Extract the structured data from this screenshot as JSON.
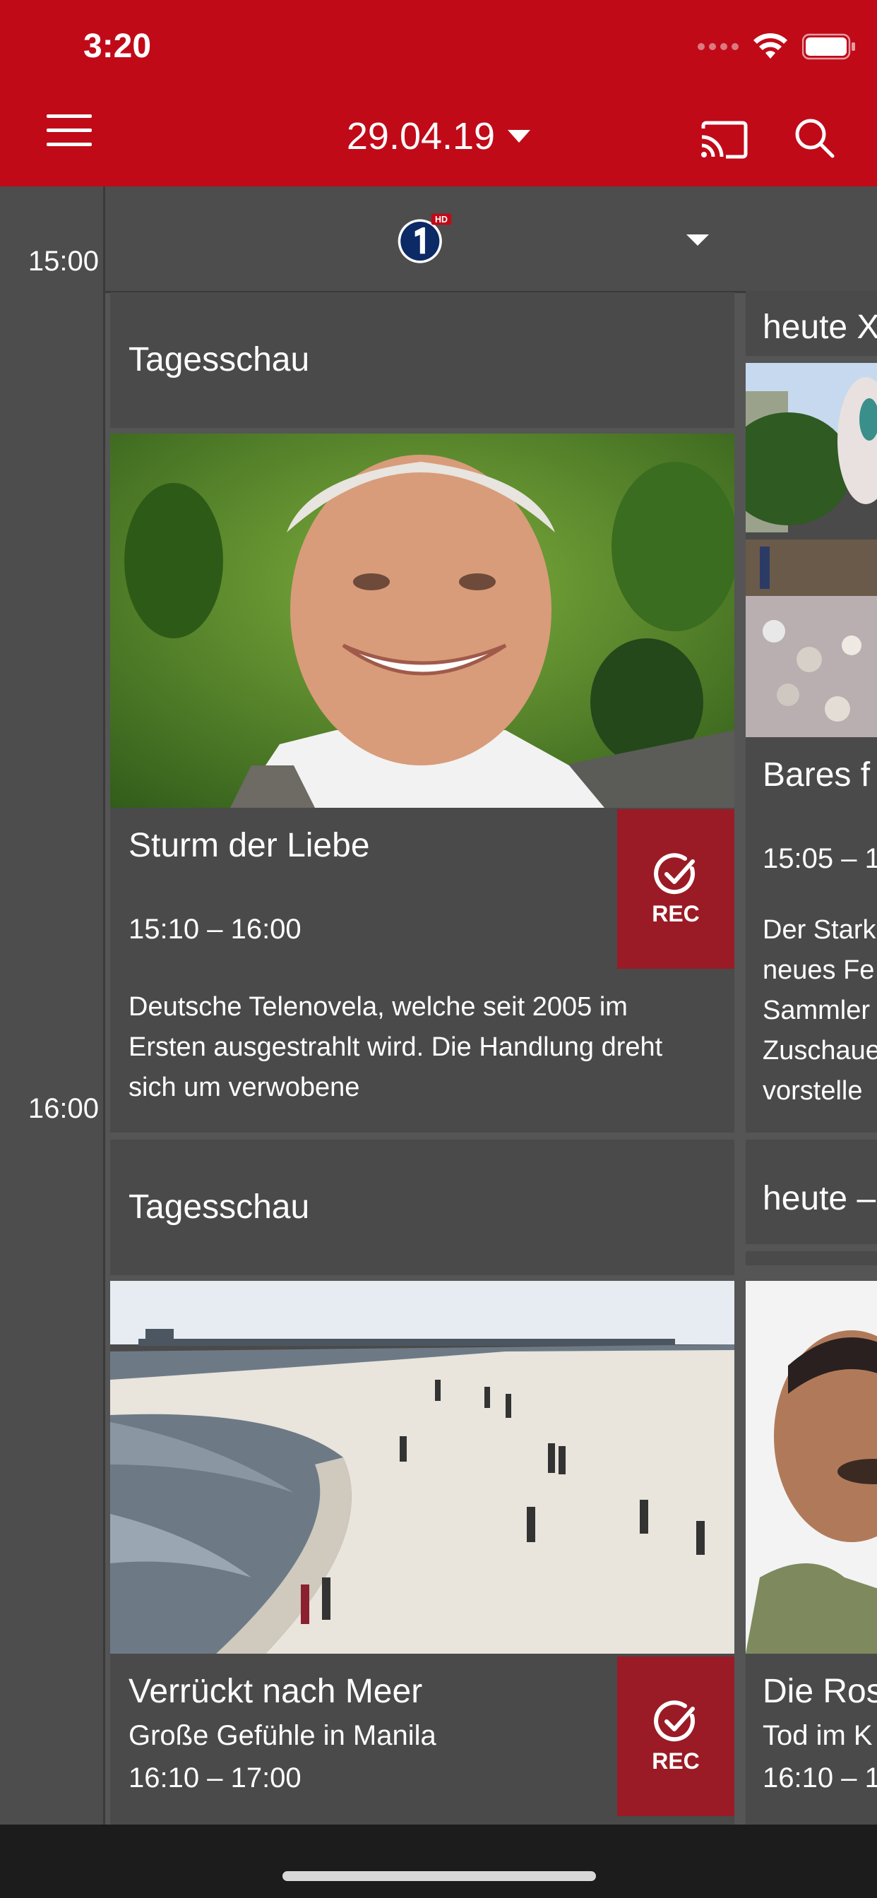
{
  "status_bar": {
    "time": "3:20"
  },
  "header": {
    "date": "29.04.19"
  },
  "channel": {
    "logo_text": "1",
    "badge": "HD"
  },
  "time_labels": {
    "t1": "15:00",
    "t2": "16:00"
  },
  "column1": {
    "news1_title": "Tagesschau",
    "prog1": {
      "title": "Sturm der Liebe",
      "time": "15:10 – 16:00",
      "desc": "Deutsche Telenovela, welche seit 2005 im Ersten ausgestrahlt wird. Die Handlung dreht sich um verwobene",
      "rec": "REC"
    },
    "news2_title": "Tagesschau",
    "prog2": {
      "title": "Verrückt nach Meer",
      "subtitle": "Große Gefühle in Manila",
      "time": "16:10 – 17:00",
      "rec": "REC"
    }
  },
  "column2": {
    "news1_title": "heute X",
    "prog1": {
      "title": "Bares f",
      "time": "15:05 – 1",
      "desc_lines": [
        "Der Stark",
        "neues Fe",
        "Sammler",
        "Zuschaue",
        "vorstelle"
      ]
    },
    "news2_title": "heute –",
    "prog2": {
      "title": "Die Ros",
      "subtitle": "Tod im K",
      "time": "16:10 – 1"
    }
  },
  "colors": {
    "brand_red": "#c00a18",
    "rec_red": "#9a1b25",
    "background": "#555555"
  }
}
